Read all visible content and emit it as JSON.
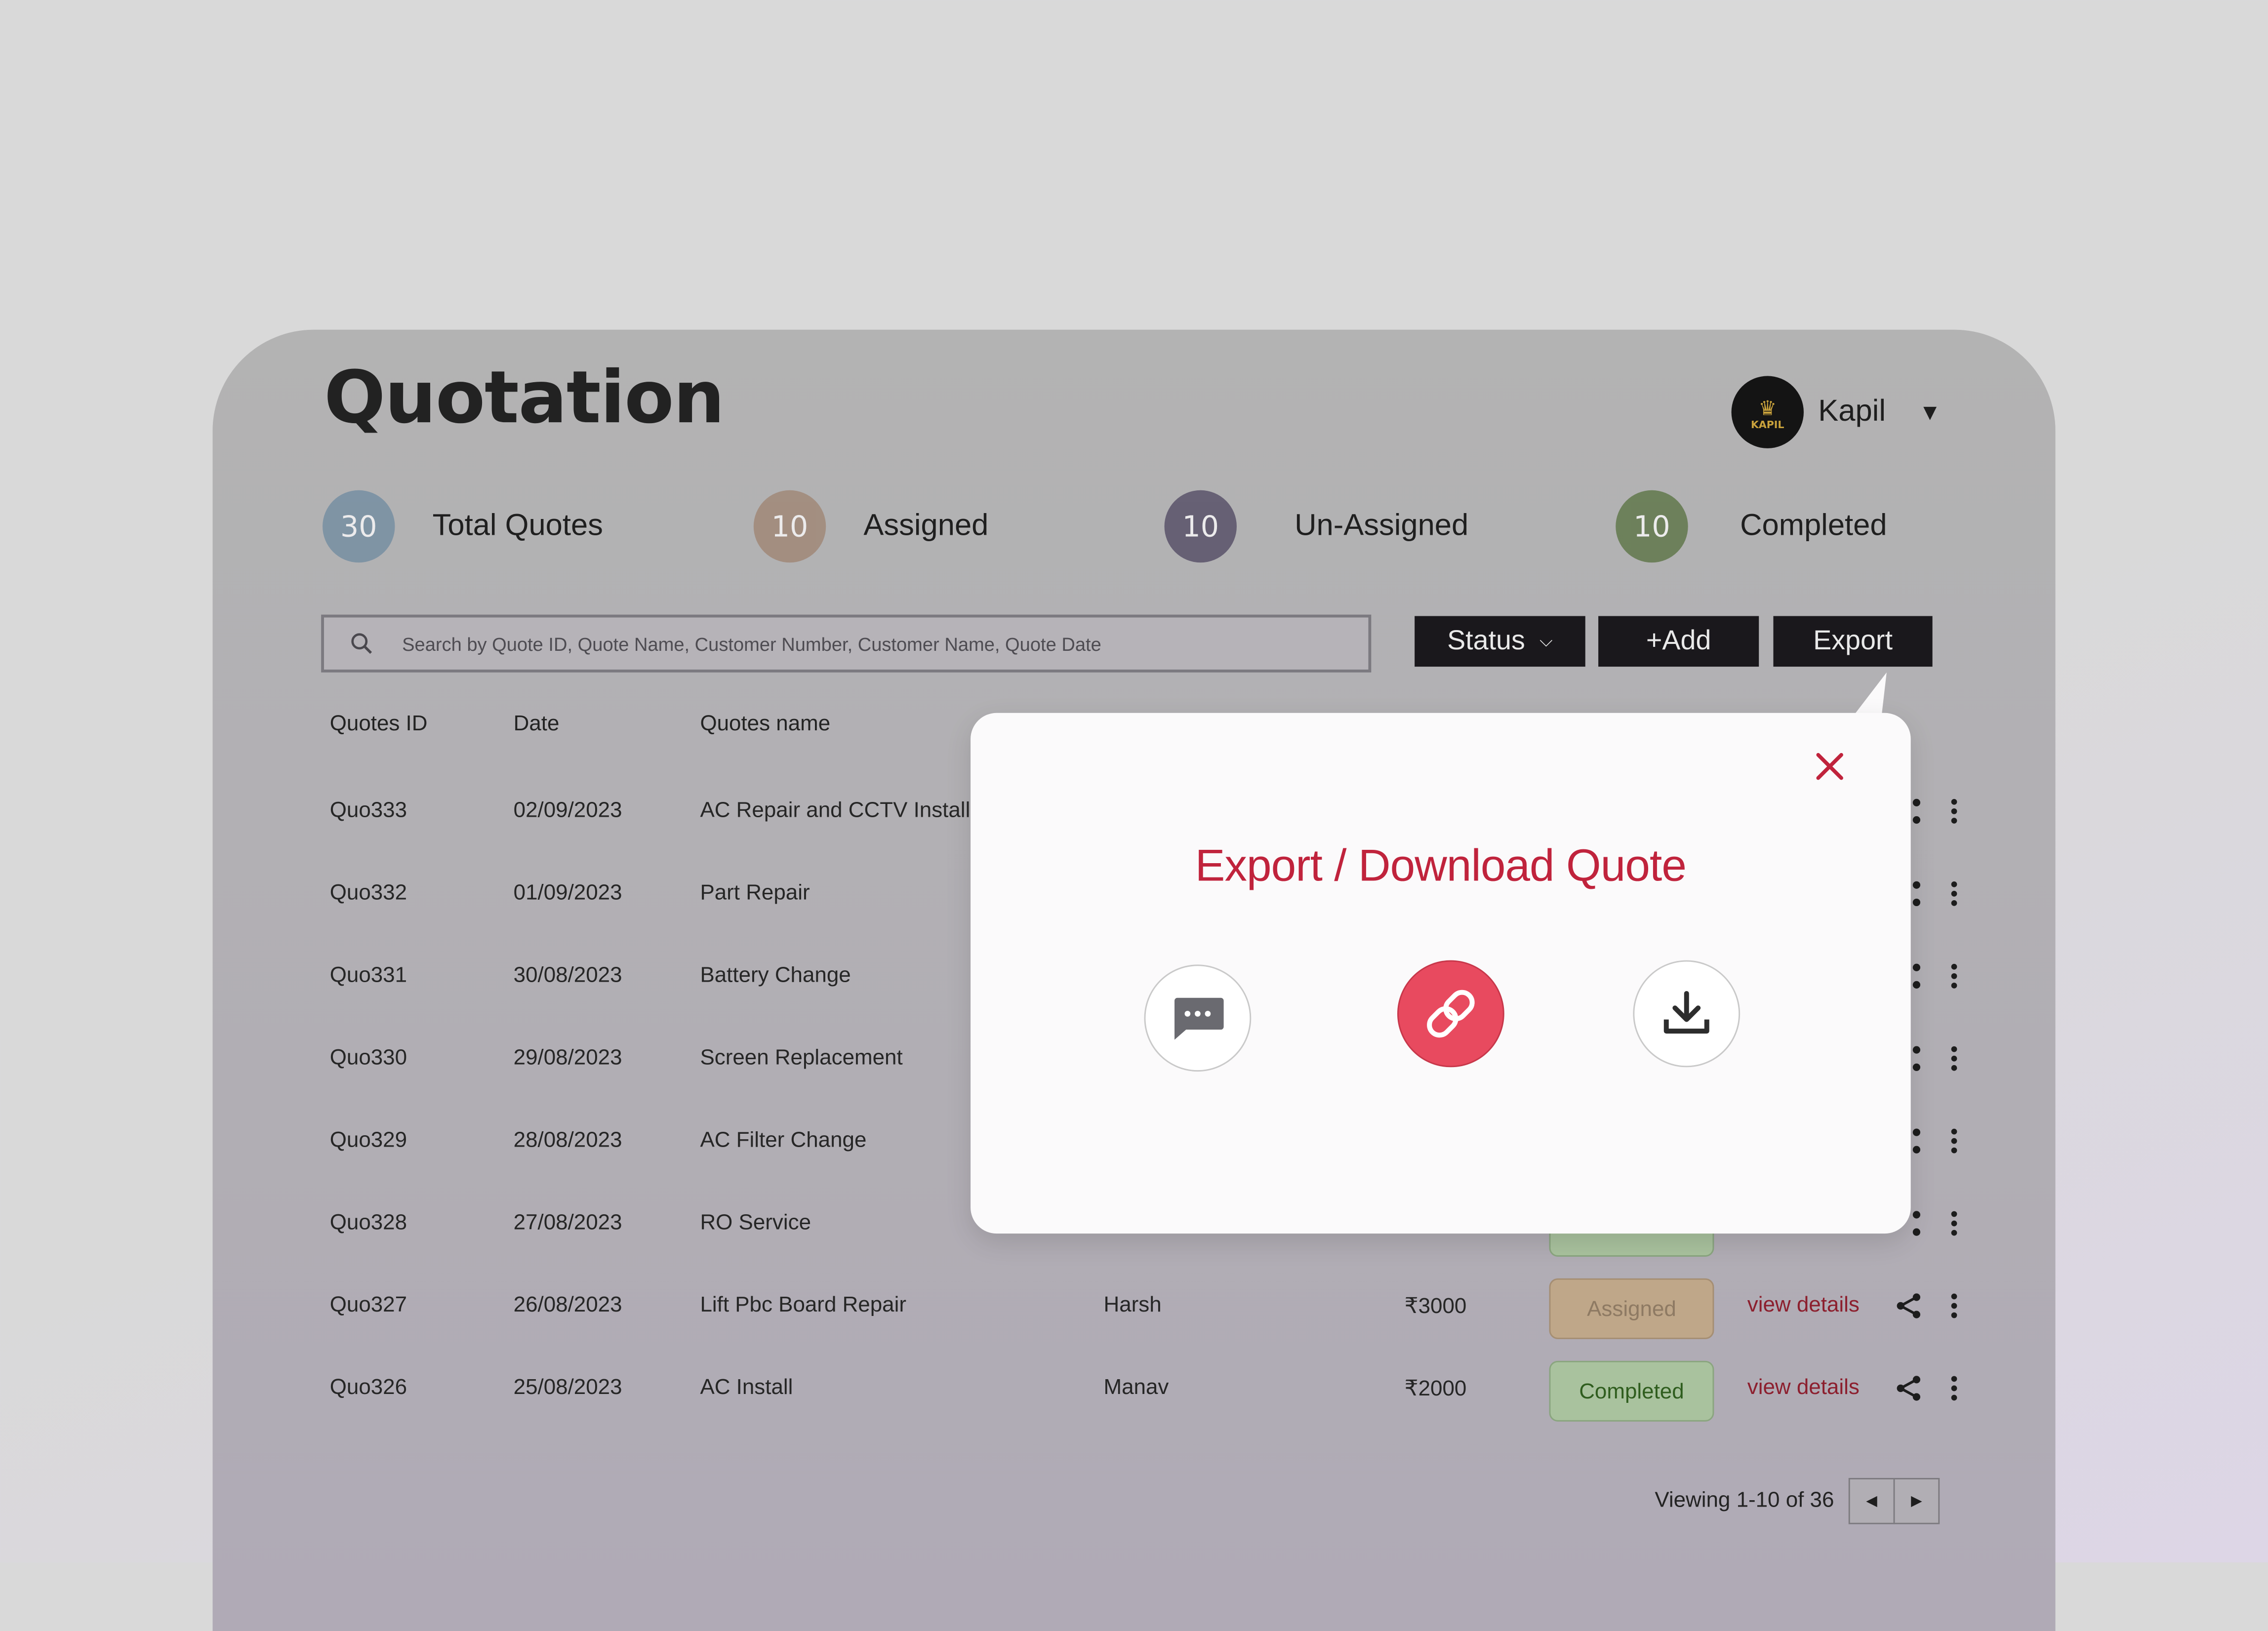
{
  "page": {
    "title": "Quotation"
  },
  "user": {
    "name": "Kapil",
    "logo_text": "KAPIL"
  },
  "stats": [
    {
      "count": "30",
      "label": "Total Quotes",
      "color": "#6e8aa0"
    },
    {
      "count": "10",
      "label": "Assigned",
      "color": "#9e8370"
    },
    {
      "count": "10",
      "label": "Un-Assigned",
      "color": "#4d4560"
    },
    {
      "count": "10",
      "label": "Completed",
      "color": "#56703e"
    }
  ],
  "search": {
    "placeholder": "Search by Quote ID, Quote Name, Customer Number, Customer Name, Quote Date"
  },
  "toolbar": {
    "status_label": "Status",
    "add_label": "+Add",
    "export_label": "Export"
  },
  "table": {
    "headers": [
      "Quotes ID",
      "Date",
      "Quotes name"
    ],
    "rows": [
      {
        "id": "Quo333",
        "date": "02/09/2023",
        "name": "AC Repair and CCTV Install"
      },
      {
        "id": "Quo332",
        "date": "01/09/2023",
        "name": "Part Repair"
      },
      {
        "id": "Quo331",
        "date": "30/08/2023",
        "name": "Battery Change"
      },
      {
        "id": "Quo330",
        "date": "29/08/2023",
        "name": "Screen Replacement"
      },
      {
        "id": "Quo329",
        "date": "28/08/2023",
        "name": "AC Filter Change"
      },
      {
        "id": "Quo328",
        "date": "27/08/2023",
        "name": "RO Service"
      },
      {
        "id": "Quo327",
        "date": "26/08/2023",
        "name": "Lift Pbc Board Repair",
        "customer": "Harsh",
        "amount": "₹3000",
        "status": "Assigned",
        "link": "view details"
      },
      {
        "id": "Quo326",
        "date": "25/08/2023",
        "name": "AC Install",
        "customer": "Manav",
        "amount": "₹2000",
        "status": "Completed",
        "link": "view details"
      }
    ]
  },
  "pagination": {
    "text": "Viewing 1-10 of 36"
  },
  "modal": {
    "title": "Export / Download Quote",
    "accent": "#c0233c"
  }
}
